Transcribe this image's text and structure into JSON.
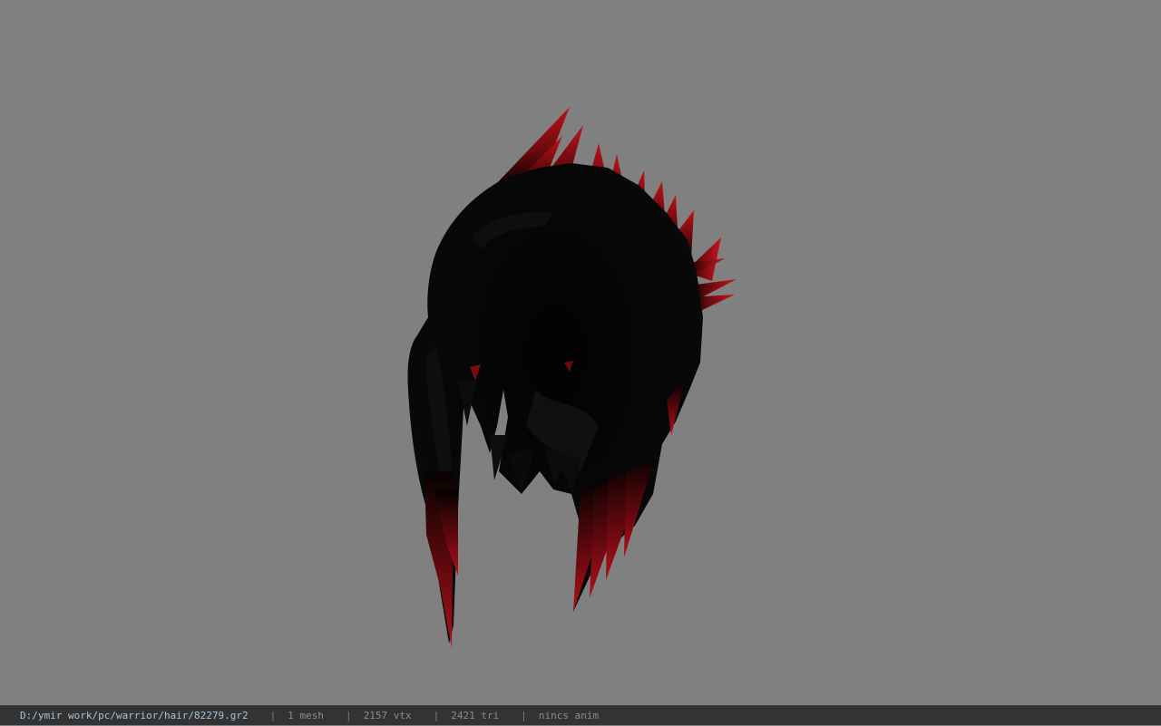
{
  "viewport": {
    "background_color": "#808080",
    "model": {
      "name": "hair-mesh",
      "base_color": "#060606",
      "tip_color": "#c0121a"
    }
  },
  "status_bar": {
    "file_path": "D:/ymir work/pc/warrior/hair/82279.gr2",
    "separator": "|",
    "mesh_count": "1 mesh",
    "vertex_count": "2157 vtx",
    "triangle_count": "2421 tri",
    "animation": "nincs anim"
  }
}
